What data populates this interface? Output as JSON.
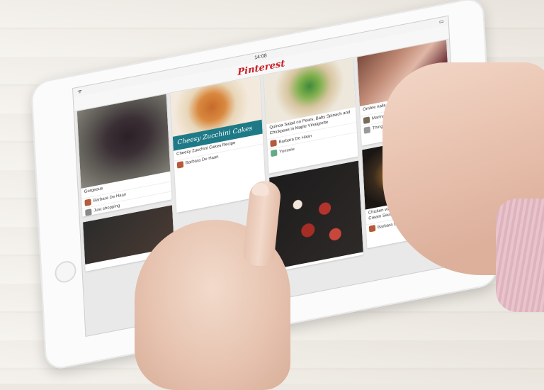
{
  "device": {
    "status_time": "14:08",
    "app_logo": "Pinterest"
  },
  "pins": [
    {
      "id": "dress",
      "description": "Gorgeous",
      "pinned_by": "Barbara De Haan",
      "board": "Just shopping"
    },
    {
      "id": "zucchini",
      "overlay_title": "Cheesy Zucchini Cakes",
      "description": "Cheesy Zucchini Cakes Recipe",
      "pinned_by": "Barbara De Haan",
      "board": ""
    },
    {
      "id": "salad",
      "description": "Quinoa Salad on Pears, Baby Spinach and Chickpeas in Maple Vinaigrette",
      "pinned_by": "Barbara De Haan",
      "board": "Yummie"
    },
    {
      "id": "hands",
      "description": "Ombre nails with an embellished accent",
      "pinned_by": "Marina van Staren",
      "board": "Things I love"
    },
    {
      "id": "pan",
      "description": "Chicken with Mushrooms, Light Balsamic Cream Sauce",
      "pinned_by": "Barbara De Haan",
      "board": ""
    }
  ],
  "colors": {
    "brand": "#cb2027",
    "accent_teal": "#1e7a86"
  }
}
